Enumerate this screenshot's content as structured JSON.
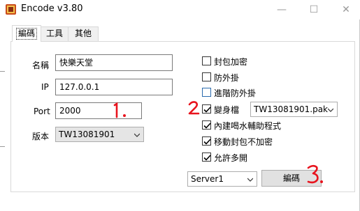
{
  "window": {
    "title": "Encode v3.80",
    "minimize_glyph": "—",
    "maximize_glyph": "☐",
    "close_glyph": "✕"
  },
  "tabs": [
    {
      "label": "編碼",
      "active": true
    },
    {
      "label": "工具",
      "active": false
    },
    {
      "label": "其他",
      "active": false
    }
  ],
  "form": {
    "name_label": "名稱",
    "name_value": "快樂天堂",
    "ip_label": "IP",
    "ip_value": "127.0.0.1",
    "port_label": "Port",
    "port_value": "2000",
    "version_label": "版本",
    "version_value": "TW13081901"
  },
  "options": [
    {
      "label": "封包加密",
      "checked": false
    },
    {
      "label": "防外掛",
      "checked": false
    },
    {
      "label": "進階防外掛",
      "checked": false
    },
    {
      "label": "變身檔",
      "checked": true
    },
    {
      "label": "內建喝水輔助程式",
      "checked": true
    },
    {
      "label": "移動封包不加密",
      "checked": true
    },
    {
      "label": "允許多開",
      "checked": true
    }
  ],
  "morph_file": {
    "value": "TW13081901.pak"
  },
  "server": {
    "value": "Server1"
  },
  "encode_button": {
    "label": "編碼"
  },
  "annotations": {
    "mark_1": "1.",
    "mark_2": "2",
    "mark_3": "3."
  },
  "colors": {
    "annotation_red": "#e8141e",
    "checkbox_blue": "#2a6aad"
  },
  "icons": {
    "app": "app-icon",
    "dropdown": "chevron-down-icon",
    "check": "check-icon"
  }
}
